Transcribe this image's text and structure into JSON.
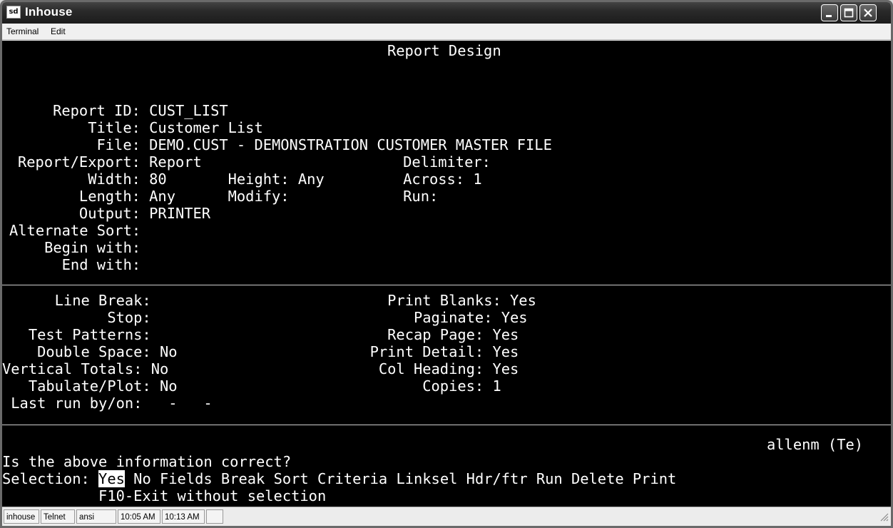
{
  "window": {
    "title": "Inhouse",
    "app_icon_text": "sd"
  },
  "menu": {
    "terminal": "Terminal",
    "edit": "Edit"
  },
  "screen": {
    "heading": "Report Design",
    "lines_top": [
      "    Report ID: CUST_LIST",
      "        Title: Customer List",
      "         File: DEMO.CUST - DEMONSTRATION CUSTOMER MASTER FILE",
      "Report/Export: Report                       Delimiter:",
      "        Width: 80       Height: Any         Across: 1",
      "       Length: Any      Modify:             Run:",
      "       Output: PRINTER",
      "Alternate Sort:",
      "    Begin with:",
      "      End with:"
    ],
    "lines_mid": [
      "      Line Break:                           Print Blanks: Yes",
      "            Stop:                              Paginate: Yes",
      "   Test Patterns:                           Recap Page: Yes",
      "    Double Space: No                      Print Detail: Yes",
      "Vertical Totals: No                        Col Heading: Yes",
      "   Tabulate/Plot: No                            Copies: 1",
      " Last run by/on:   -   -"
    ],
    "user_status": "allenm (Te)",
    "prompt": "Is the above information correct?",
    "selection_label": "Selection: ",
    "selection_default": "Yes",
    "selection_rest": " No Fields Break Sort Criteria Linksel Hdr/ftr Run Delete Print",
    "exit_hint": "           F10-Exit without selection"
  },
  "statusbar": {
    "host": "inhouse",
    "protocol": "Telnet",
    "emulation": "ansi",
    "time_connected": "10:05 AM",
    "time_current": "10:13 AM"
  },
  "colors": {
    "terminal_bg": "#000000",
    "terminal_fg": "#ffffff",
    "titlebar": "#2a2a2a"
  }
}
